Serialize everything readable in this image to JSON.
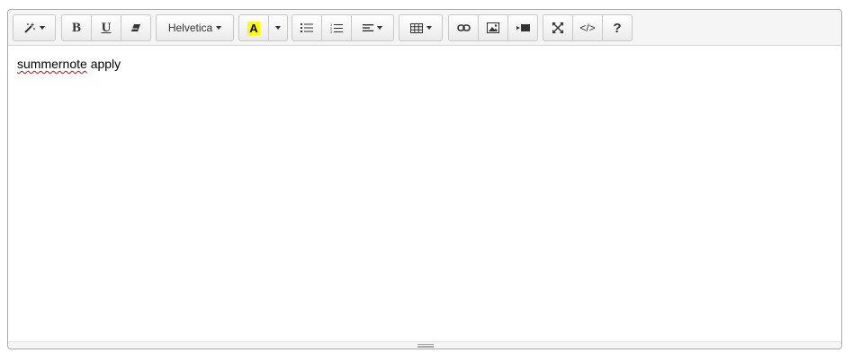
{
  "toolbar": {
    "style_icon": "magic-wand-icon",
    "bold_label": "B",
    "underline_label": "U",
    "eraser_icon": "eraser-icon",
    "font_name": "Helvetica",
    "color_label": "A",
    "highlight_color": "#ffff00",
    "unordered_list_icon": "unordered-list-icon",
    "ordered_list_icon": "ordered-list-icon",
    "align_icon": "align-left-icon",
    "table_icon": "table-icon",
    "link_icon": "link-icon",
    "picture_icon": "picture-icon",
    "video_icon": "video-icon",
    "fullscreen_icon": "fullscreen-icon",
    "codeview_label": "</>",
    "help_label": "?"
  },
  "content": {
    "word1": "summernote",
    "word2": "apply"
  }
}
